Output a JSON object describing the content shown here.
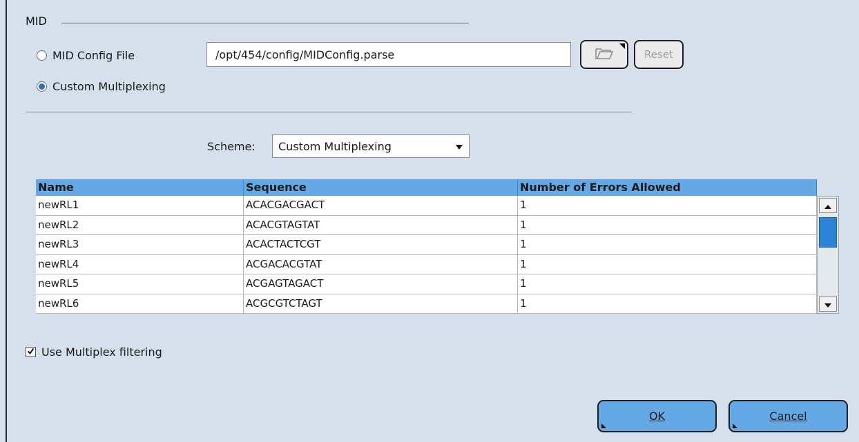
{
  "group": {
    "title": "MID"
  },
  "config": {
    "file_option_label": "MID Config File",
    "file_path": "/opt/454/config/MIDConfig.parse",
    "reset_label": "Reset",
    "custom_option_label": "Custom Multiplexing",
    "selected_option": "Custom Multiplexing"
  },
  "scheme": {
    "label": "Scheme:",
    "selected": "Custom Multiplexing"
  },
  "table": {
    "columns": [
      "Name",
      "Sequence",
      "Number of Errors Allowed"
    ],
    "rows": [
      [
        "newRL1",
        "ACACGACGACT",
        "1"
      ],
      [
        "newRL2",
        "ACACGTAGTAT",
        "1"
      ],
      [
        "newRL3",
        "ACACTACTCGT",
        "1"
      ],
      [
        "newRL4",
        "ACGACACGTAT",
        "1"
      ],
      [
        "newRL5",
        "ACGAGTAGACT",
        "1"
      ],
      [
        "newRL6",
        "ACGCGTCTAGT",
        "1"
      ]
    ]
  },
  "filtering": {
    "label": "Use Multiplex filtering",
    "checked": true
  },
  "actions": {
    "ok_label": "OK",
    "cancel_label": "Cancel"
  },
  "icons": {
    "open_folder": "folder-open-icon",
    "scroll_up": "arrow-up-icon",
    "scroll_down": "arrow-down-icon",
    "dropdown": "triangle-down-icon",
    "check": "check-icon"
  },
  "colors": {
    "background": "#d5e0ec",
    "header_blue": "#64a8e6",
    "button_blue": "#64a8e6",
    "radio_selected": "#2a6fc5",
    "scroll_thumb": "#2d83d6"
  }
}
